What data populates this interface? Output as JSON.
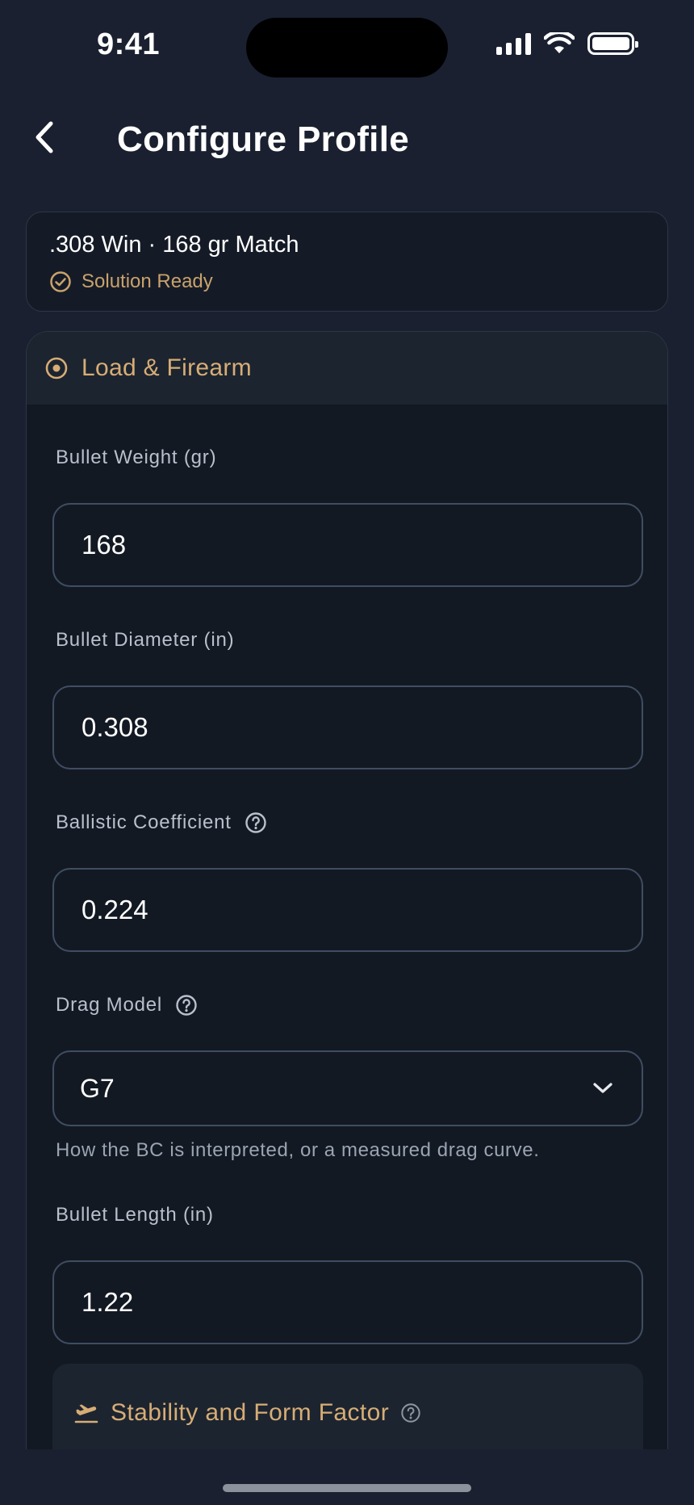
{
  "status_bar": {
    "time": "9:41"
  },
  "header": {
    "title": "Configure Profile",
    "back_icon": "chevron-left-icon"
  },
  "summary": {
    "title": ".308 Win · 168 gr Match",
    "status": "Solution Ready",
    "status_icon": "check-circle-icon"
  },
  "section": {
    "title": "Load & Firearm",
    "icon": "radio-target-icon",
    "fields": {
      "bullet_weight": {
        "label": "Bullet Weight (gr)",
        "value": "168"
      },
      "bullet_diameter": {
        "label": "Bullet Diameter (in)",
        "value": "0.308"
      },
      "ballistic_coefficient": {
        "label": "Ballistic Coefficient",
        "value": "0.224"
      },
      "drag_model": {
        "label": "Drag Model",
        "value": "G7",
        "hint": "How the BC is interpreted, or a measured drag curve."
      },
      "bullet_length": {
        "label": "Bullet Length (in)",
        "value": "1.22"
      }
    },
    "subsection": {
      "title": "Stability and Form Factor",
      "icon": "plane-takeoff-icon"
    }
  },
  "colors": {
    "background": "#1a2030",
    "accent": "#d7ad75",
    "status": "#c9a26c",
    "input_border": "#3f4d62"
  }
}
